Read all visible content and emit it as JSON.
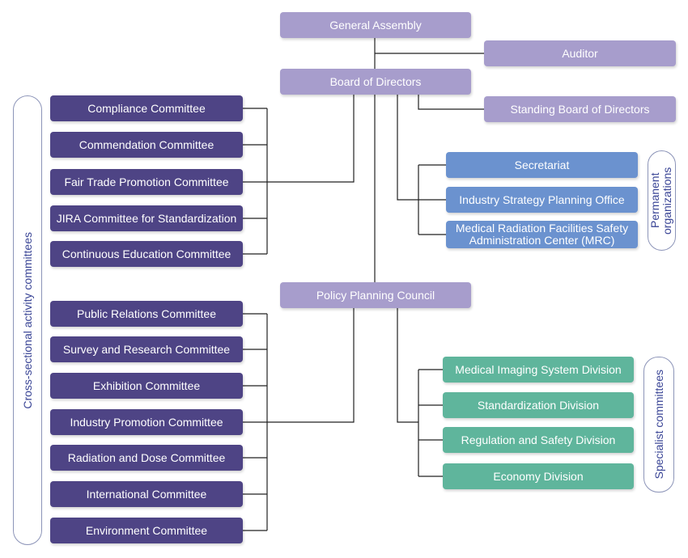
{
  "top": {
    "general_assembly": "General Assembly",
    "auditor": "Auditor",
    "board_of_directors": "Board of Directors",
    "standing_board": "Standing Board of Directors",
    "policy_planning_council": "Policy Planning Council"
  },
  "cross_sectional_label": "Cross-sectional activity committees",
  "board_committees": [
    "Compliance Committee",
    "Commendation Committee",
    "Fair Trade Promotion Committee",
    "JIRA Committee for Standardization",
    "Continuous Education Committee"
  ],
  "council_committees": [
    "Public Relations Committee",
    "Survey and Research Committee",
    "Exhibition Committee",
    "Industry Promotion Committee",
    "Radiation and Dose Committee",
    "International Committee",
    "Environment Committee"
  ],
  "permanent": {
    "label": "Permanent organizations",
    "items": [
      "Secretariat",
      "Industry Strategy Planning Office",
      "Medical Radiation Facilities Safety Administration Center (MRC)"
    ]
  },
  "specialist": {
    "label": "Specialist committees",
    "items": [
      "Medical Imaging System Division",
      "Standardization Division",
      "Regulation and Safety Division",
      "Economy Division"
    ]
  },
  "colors": {
    "light_purple": "#a79dcc",
    "dark_purple": "#4e4485",
    "blue": "#6b92cf",
    "teal": "#5fb59c",
    "label_text": "#3a4596"
  }
}
